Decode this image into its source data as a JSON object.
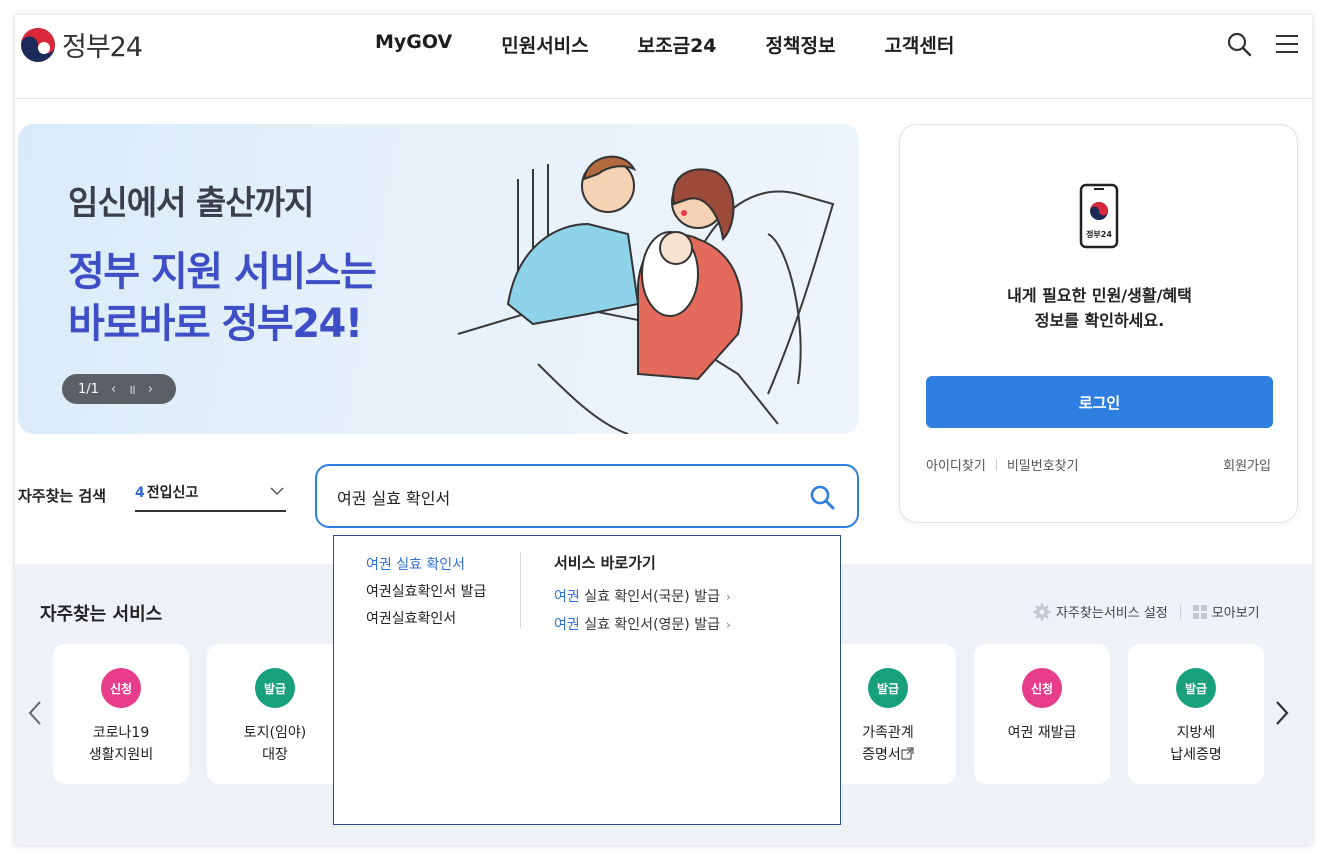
{
  "header": {
    "logo_text": "정부24",
    "nav": [
      "MyGOV",
      "민원서비스",
      "보조금24",
      "정책정보",
      "고객센터"
    ]
  },
  "banner": {
    "subtitle": "임신에서 출산까지",
    "title_line1": "정부 지원 서비스는",
    "title_line2": "바로바로 정부24!",
    "pager": "1/1"
  },
  "login": {
    "phone_label": "정부24",
    "message_line1": "내게 필요한 민원/생활/혜택",
    "message_line2": "정보를 확인하세요.",
    "button": "로그인",
    "find_id": "아이디찾기",
    "find_pw": "비밀번호찾기",
    "join": "회원가입"
  },
  "search": {
    "freq_label": "자주찾는 검색",
    "freq_rank": "4",
    "freq_term": "전입신고",
    "value": "여권 실효 확인서"
  },
  "autocomplete": {
    "suggestions": [
      "여권 실효 확인서",
      "여권실효확인서 발급",
      "여권실효확인서"
    ],
    "shortcut_heading": "서비스 바로가기",
    "shortcuts": [
      {
        "highlight": "여권",
        "rest": " 실효 확인서(국문) 발급"
      },
      {
        "highlight": "여권",
        "rest": " 실효 확인서(영문) 발급"
      }
    ],
    "arrow": "›"
  },
  "services": {
    "title": "자주찾는 서비스",
    "setting": "자주찾는서비스 설정",
    "view_all": "모아보기",
    "cards": [
      {
        "badge": "신청",
        "type": "apply",
        "line1": "코로나19",
        "line2": "생활지원비"
      },
      {
        "badge": "발급",
        "type": "issue",
        "line1": "토지(임야)",
        "line2": "대장"
      },
      {
        "badge": "발급",
        "type": "issue",
        "line1": "가족관계",
        "line2": "증명서"
      },
      {
        "badge": "신청",
        "type": "apply",
        "line1": "여권 재발급",
        "line2": ""
      },
      {
        "badge": "발급",
        "type": "issue",
        "line1": "지방세",
        "line2": "납세증명"
      }
    ]
  },
  "colors": {
    "accent": "#2f7fe0",
    "banner_title": "#3d4ec7",
    "badge_apply": "#e83c8c",
    "badge_issue": "#17a07a"
  }
}
